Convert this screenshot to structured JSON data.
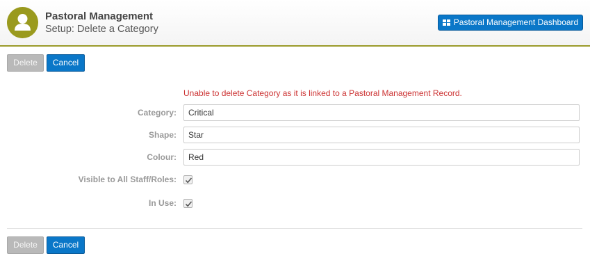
{
  "header": {
    "app_title": "Pastoral Management",
    "page_subtitle": "Setup: Delete a Category",
    "dashboard_button": "Pastoral Management Dashboard"
  },
  "actions": {
    "delete_label": "Delete",
    "cancel_label": "Cancel"
  },
  "form": {
    "error_message": "Unable to delete Category as it is linked to a Pastoral Management Record.",
    "category_label": "Category:",
    "category_value": "Critical",
    "shape_label": "Shape:",
    "shape_value": "Star",
    "colour_label": "Colour:",
    "colour_value": "Red",
    "visible_label": "Visible to All Staff/Roles:",
    "visible_checked": true,
    "in_use_label": "In Use:",
    "in_use_checked": true
  },
  "colors": {
    "accent_olive": "#9a9a1e",
    "primary_blue": "#0a77c8",
    "error_red": "#cc3333",
    "disabled_grey": "#b9b9b9"
  },
  "icons": {
    "avatar": "user-icon",
    "dashboard": "grid-icon",
    "checkbox": "checkmark-icon"
  }
}
